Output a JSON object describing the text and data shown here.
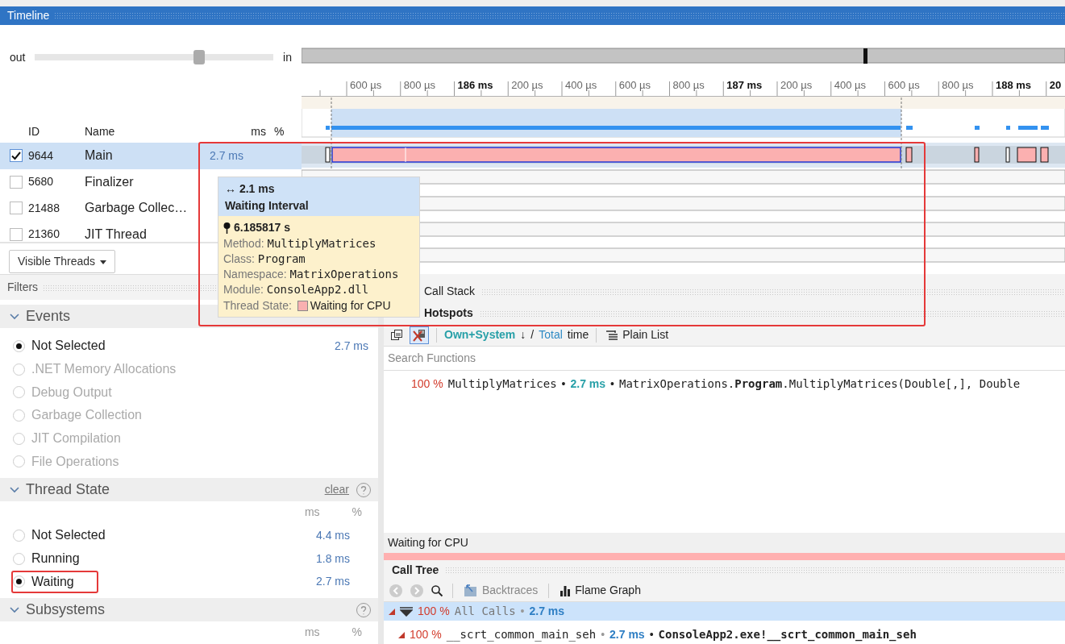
{
  "panel_title": "Timeline",
  "zoom": {
    "out_label": "out",
    "in_label": "in",
    "level": 0.69
  },
  "ruler": [
    {
      "label": "600 µs",
      "major": false
    },
    {
      "label": "800 µs",
      "major": false
    },
    {
      "label": "186 ms",
      "major": true
    },
    {
      "label": "200 µs",
      "major": false
    },
    {
      "label": "400 µs",
      "major": false
    },
    {
      "label": "600 µs",
      "major": false
    },
    {
      "label": "800 µs",
      "major": false
    },
    {
      "label": "187 ms",
      "major": true
    },
    {
      "label": "200 µs",
      "major": false
    },
    {
      "label": "400 µs",
      "major": false
    },
    {
      "label": "600 µs",
      "major": false
    },
    {
      "label": "800 µs",
      "major": false
    },
    {
      "label": "188 ms",
      "major": true
    },
    {
      "label": "20",
      "major": true
    }
  ],
  "threads": {
    "columns": [
      "ID",
      "Name",
      "ms",
      "%"
    ],
    "rows": [
      {
        "id": "9644",
        "name": "Main",
        "ms": "2.7 ms",
        "checked": true,
        "selected": true
      },
      {
        "id": "5680",
        "name": "Finalizer",
        "checked": false,
        "selected": false
      },
      {
        "id": "21488",
        "name": "Garbage Collec…",
        "checked": false,
        "selected": false
      },
      {
        "id": "21360",
        "name": "JIT Thread",
        "checked": false,
        "selected": false
      }
    ]
  },
  "visible_threads_button": "Visible Threads",
  "tooltip": {
    "duration": "↔ 2.1 ms",
    "title": "Waiting Interval",
    "time": "6.185817 s",
    "framed": true,
    "fields": [
      {
        "label": "Method:",
        "value": "MultiplyMatrices"
      },
      {
        "label": "Class:",
        "value": "Program"
      },
      {
        "label": "Namespace:",
        "value": "MatrixOperations"
      },
      {
        "label": "Module:",
        "value": "ConsoleApp2.dll"
      }
    ],
    "thread_state": {
      "label": "Thread State:",
      "value": "Waiting for CPU",
      "color": "#f9b0b0"
    }
  },
  "filters": {
    "title": "Filters",
    "sections": [
      {
        "kind": "options",
        "title": "Events",
        "expanded": true,
        "options": [
          {
            "label": "Not Selected",
            "value": "2.7 ms",
            "selected": true,
            "disabled": false
          },
          {
            "label": ".NET Memory Allocations",
            "selected": false,
            "disabled": true
          },
          {
            "label": "Debug Output",
            "selected": false,
            "disabled": true
          },
          {
            "label": "Garbage Collection",
            "selected": false,
            "disabled": true
          },
          {
            "label": "JIT Compilation",
            "selected": false,
            "disabled": true
          },
          {
            "label": "File Operations",
            "selected": false,
            "disabled": true
          }
        ]
      },
      {
        "kind": "options",
        "title": "Thread State",
        "expanded": true,
        "clear": "clear",
        "help": true,
        "columns": [
          "ms",
          "%"
        ],
        "options": [
          {
            "label": "Not Selected",
            "value": "4.4 ms",
            "selected": false,
            "disabled": false
          },
          {
            "label": "Running",
            "value": "1.8 ms",
            "selected": false,
            "disabled": false
          },
          {
            "label": "Waiting",
            "value": "2.7 ms",
            "selected": true,
            "disabled": false,
            "framed": true
          }
        ]
      },
      {
        "kind": "columns",
        "title": "Subsystems",
        "expanded": true,
        "help": true,
        "columns": [
          "ms",
          "%"
        ]
      }
    ]
  },
  "call_stack": {
    "title": "Call Stack"
  },
  "hotspots": {
    "title": "Hotspots",
    "sort_own": "Own+System",
    "sort_arrow": "↓",
    "separator": "/",
    "sort_total": "Total",
    "sort_suffix": "time",
    "plain_list": "Plain List",
    "search_placeholder": "Search Functions",
    "rows": [
      {
        "percent": "100 %",
        "name": "MultiplyMatrices",
        "separators": [
          "•",
          "•"
        ],
        "time": "2.7 ms",
        "signature": "MatrixOperations.**Program**.MultiplyMatrices(Double[,], Double"
      }
    ]
  },
  "state_bar": {
    "label": "Waiting for CPU",
    "color": "#ffb0b0"
  },
  "call_tree": {
    "title": "Call Tree",
    "backtraces": "Backtraces",
    "flame_graph": "Flame Graph",
    "rows": [
      {
        "kind": "root",
        "percent": "100 %",
        "name": "All Calls",
        "separators": [
          "•"
        ],
        "time": "2.7 ms",
        "selected": true,
        "expanded": true
      },
      {
        "kind": "call",
        "percent": "100 %",
        "name": "__scrt_common_main_seh",
        "separators": [
          "•",
          "•"
        ],
        "time": "2.7 ms",
        "signature": "ConsoleApp2.exe!__scrt_common_main_seh",
        "selected": false,
        "expanded": true
      }
    ]
  }
}
